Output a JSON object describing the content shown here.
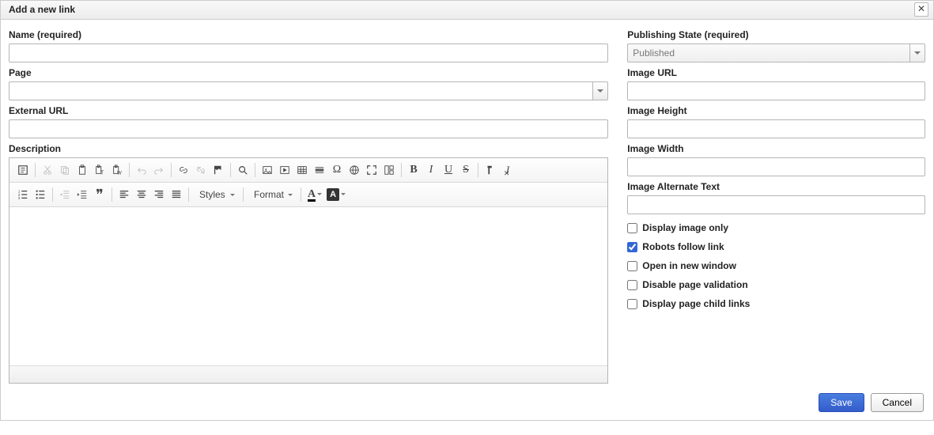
{
  "dialog": {
    "title": "Add a new link"
  },
  "left": {
    "name_label": "Name (required)",
    "name_value": "",
    "page_label": "Page",
    "page_value": "",
    "external_url_label": "External URL",
    "external_url_value": "",
    "description_label": "Description"
  },
  "right": {
    "pubstate_label": "Publishing State (required)",
    "pubstate_value": "Published",
    "image_url_label": "Image URL",
    "image_url_value": "",
    "image_height_label": "Image Height",
    "image_height_value": "",
    "image_width_label": "Image Width",
    "image_width_value": "",
    "image_alt_label": "Image Alternate Text",
    "image_alt_value": "",
    "display_image_only_label": "Display image only",
    "robots_follow_label": "Robots follow link",
    "open_new_window_label": "Open in new window",
    "disable_validation_label": "Disable page validation",
    "display_child_links_label": "Display page child links"
  },
  "toolbar": {
    "styles_label": "Styles",
    "format_label": "Format"
  },
  "buttons": {
    "save": "Save",
    "cancel": "Cancel"
  }
}
